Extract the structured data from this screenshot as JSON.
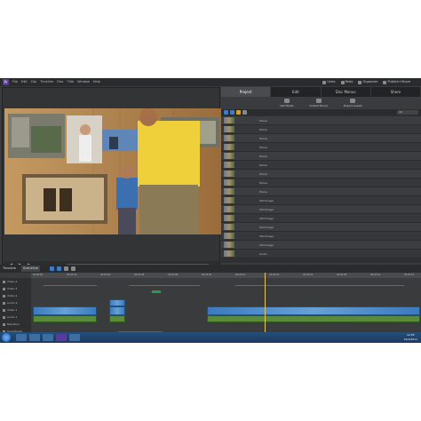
{
  "window": {
    "logo": "Pr",
    "menus": [
      "File",
      "Edit",
      "Clip",
      "Timeline",
      "Disc",
      "Title",
      "Window",
      "Help"
    ],
    "top_buttons": [
      "Undo",
      "Redo",
      "Organizer",
      "Publish+Share"
    ]
  },
  "panel": {
    "tabs": [
      "Project",
      "Edit",
      "Disc Menus",
      "Share"
    ],
    "active_tab": "Project",
    "tools": [
      "Get Media",
      "Instant Movie",
      "Project Assets"
    ],
    "view_select": "All",
    "rows": [
      [
        "",
        "Movie",
        "",
        "",
        "",
        ""
      ],
      [
        "",
        "Movie",
        "",
        "",
        "",
        ""
      ],
      [
        "",
        "Movie",
        "",
        "",
        "",
        ""
      ],
      [
        "",
        "Movie",
        "",
        "",
        "",
        ""
      ],
      [
        "",
        "Movie",
        "",
        "",
        "",
        ""
      ],
      [
        "",
        "Movie",
        "",
        "",
        "",
        ""
      ],
      [
        "",
        "Movie",
        "",
        "",
        "",
        ""
      ],
      [
        "",
        "Movie",
        "",
        "",
        "",
        ""
      ],
      [
        "",
        "Movie",
        "",
        "",
        "",
        ""
      ],
      [
        "",
        "Still Image",
        "",
        "",
        "",
        ""
      ],
      [
        "",
        "Still Image",
        "",
        "",
        "",
        ""
      ],
      [
        "",
        "Still Image",
        "",
        "",
        "",
        ""
      ],
      [
        "",
        "Still Image",
        "",
        "",
        "",
        ""
      ],
      [
        "",
        "Still Image",
        "",
        "",
        "",
        ""
      ],
      [
        "",
        "Still Image",
        "",
        "",
        "",
        ""
      ],
      [
        "",
        "Audio",
        "",
        "",
        "",
        ""
      ]
    ]
  },
  "timeline": {
    "tabs": [
      "Timeline",
      "Sceneline"
    ],
    "ruler_marks": [
      "00:00:00",
      "00:00:32",
      "00:01:04",
      "00:01:36",
      "00:02:08",
      "00:02:40",
      "00:03:12",
      "00:03:44",
      "00:04:16",
      "00:04:48",
      "00:05:20",
      "00:05:52"
    ],
    "track_labels": [
      "Video 4",
      "Video 3",
      "Video 2",
      "Audio 2",
      "Video 1",
      "Audio 1",
      "Narration",
      "Soundtrack"
    ]
  },
  "taskbar": {
    "time": "12:05",
    "date": "10/1/2011"
  },
  "colors": {
    "accent": "#3d7cc9",
    "track_clip": "#3a7bbf",
    "audio_clip": "#5c8a3c",
    "playhead": "#e8c85a",
    "warning_line": "#d23a3a"
  }
}
